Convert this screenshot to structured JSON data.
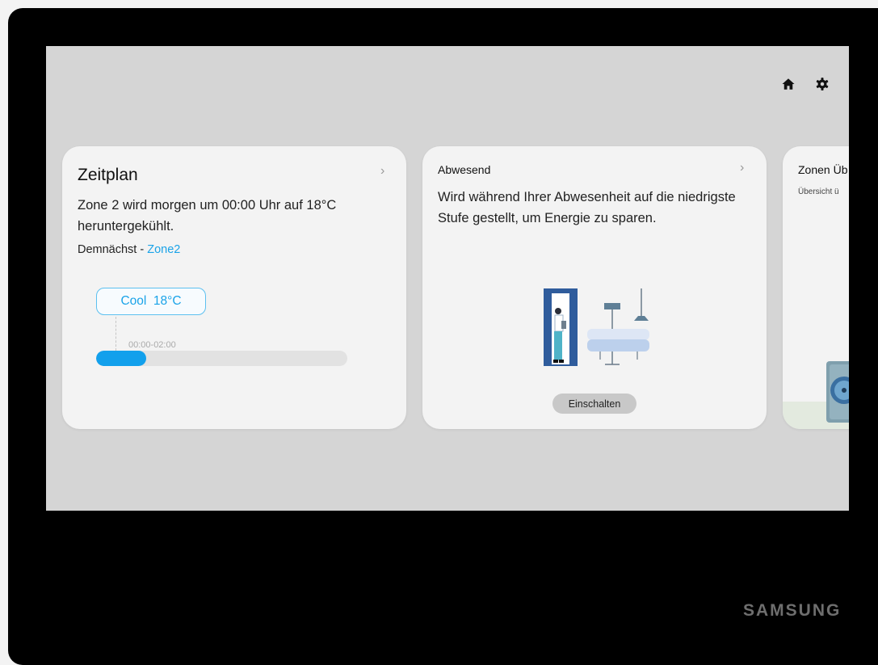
{
  "header": {
    "home_icon": "home-icon",
    "settings_icon": "gear-icon"
  },
  "schedule_card": {
    "title": "Zeitplan",
    "chevron": "›",
    "description": "Zone 2 wird morgen um 00:00 Uhr auf 18°C heruntergekühlt.",
    "upcoming_prefix": "Demnächst - ",
    "upcoming_zone": "Zone2",
    "mode_pill": "Cool  18°C",
    "time_range": "00:00-02:00",
    "progress_fraction": 0.2
  },
  "away_card": {
    "title": "Abwesend",
    "chevron": "›",
    "description": "Wird während Ihrer Abwesenheit auf die niedrigste Stufe gestellt, um Energie zu sparen.",
    "button_label": "Einschalten"
  },
  "zones_card": {
    "title": "Zonen Üb",
    "subtitle": "Übersicht ü"
  },
  "brand": "SAMSUNG",
  "colors": {
    "accent": "#1aa3e8",
    "screen_bg": "#d5d5d5",
    "card_bg": "#f3f3f3",
    "progress_fill": "#12a0ec"
  }
}
